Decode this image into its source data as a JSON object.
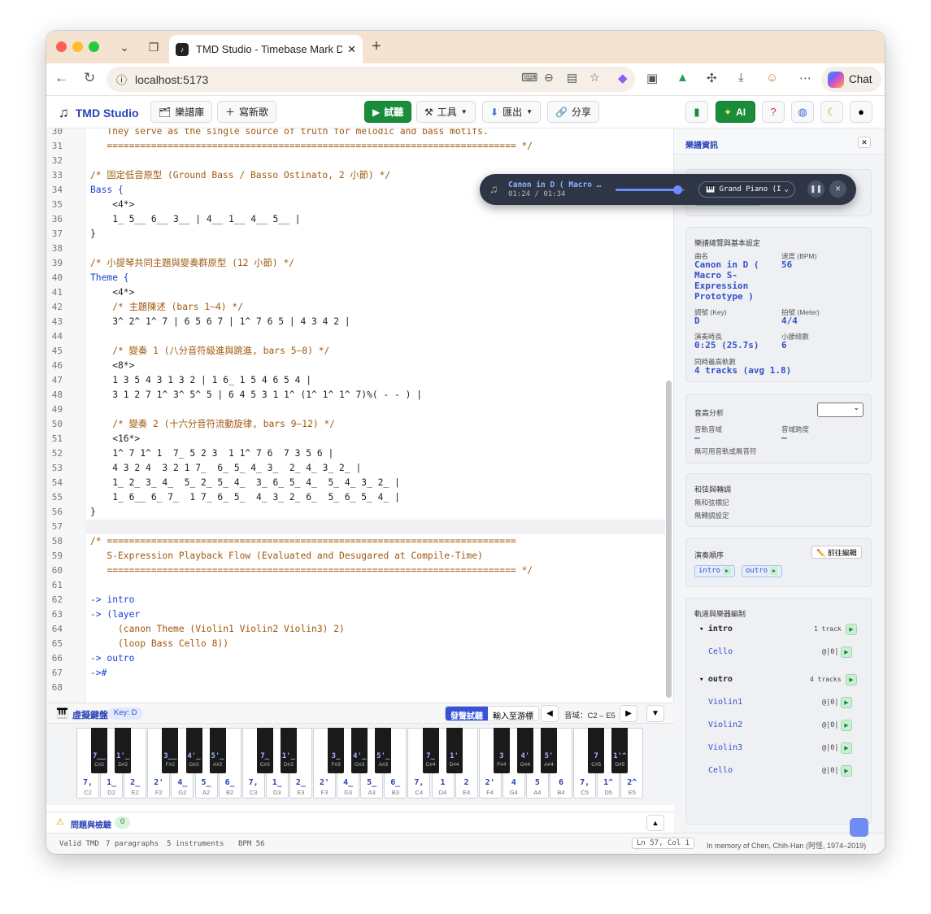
{
  "browser": {
    "tab_title": "TMD Studio - Timebase Mark Do",
    "url": "localhost:5173",
    "chat_label": "Chat"
  },
  "header": {
    "app_name": "TMD Studio",
    "library": "樂譜庫",
    "new_song": "寫新歌",
    "play": "試聽",
    "tools": "工具",
    "export": "匯出",
    "share": "分享",
    "ai": "AI"
  },
  "editor": {
    "lines": [
      {
        "n": "30",
        "t": "   They serve as the single source of truth for melodic and bass motifs.",
        "c": "cm"
      },
      {
        "n": "31",
        "t": "   ========================================================================== */",
        "c": "cm"
      },
      {
        "n": "32",
        "t": "",
        "c": ""
      },
      {
        "n": "33",
        "t": "/* 固定低音原型 (Ground Bass / Basso Ostinato, 2 小節) */",
        "c": "cm"
      },
      {
        "n": "34",
        "t": "Bass {",
        "c": "kw"
      },
      {
        "n": "35",
        "t": "    <4*>",
        "c": ""
      },
      {
        "n": "36",
        "t": "    1_ 5__ 6__ 3__ | 4__ 1__ 4__ 5__ |",
        "c": ""
      },
      {
        "n": "37",
        "t": "}",
        "c": ""
      },
      {
        "n": "38",
        "t": "",
        "c": ""
      },
      {
        "n": "39",
        "t": "/* 小提琴共同主題與變奏群原型 (12 小節) */",
        "c": "cm"
      },
      {
        "n": "40",
        "t": "Theme {",
        "c": "kw"
      },
      {
        "n": "41",
        "t": "    <4*>",
        "c": ""
      },
      {
        "n": "42",
        "t": "    /* 主題陳述 (bars 1–4) */",
        "c": "cm"
      },
      {
        "n": "43",
        "t": "    3^ 2^ 1^ 7 | 6 5 6 7 | 1^ 7 6 5 | 4 3 4 2 |",
        "c": ""
      },
      {
        "n": "44",
        "t": "",
        "c": ""
      },
      {
        "n": "45",
        "t": "    /* 變奏 1 (八分音符級進與跳進, bars 5–8) */",
        "c": "cm"
      },
      {
        "n": "46",
        "t": "    <8*>",
        "c": ""
      },
      {
        "n": "47",
        "t": "    1 3 5 4 3 1 3 2 | 1 6_ 1 5 4 6 5 4 |",
        "c": ""
      },
      {
        "n": "48",
        "t": "    3 1 2 7 1^ 3^ 5^ 5 | 6 4 5 3 1 1^ (1^ 1^ 1^ 7)%( - - ) |",
        "c": ""
      },
      {
        "n": "49",
        "t": "",
        "c": ""
      },
      {
        "n": "50",
        "t": "    /* 變奏 2 (十六分音符流動旋律, bars 9–12) */",
        "c": "cm"
      },
      {
        "n": "51",
        "t": "    <16*>",
        "c": ""
      },
      {
        "n": "52",
        "t": "    1^ 7 1^ 1  7_ 5 2 3  1 1^ 7 6  7 3 5 6 |",
        "c": ""
      },
      {
        "n": "53",
        "t": "    4 3 2 4  3 2 1 7_  6_ 5_ 4_ 3_  2_ 4_ 3_ 2_ |",
        "c": ""
      },
      {
        "n": "54",
        "t": "    1_ 2_ 3_ 4_  5_ 2_ 5_ 4_  3_ 6_ 5_ 4_  5_ 4_ 3_ 2_ |",
        "c": ""
      },
      {
        "n": "55",
        "t": "    1_ 6__ 6_ 7_  1 7_ 6_ 5_  4_ 3_ 2_ 6_  5_ 6_ 5_ 4_ |",
        "c": ""
      },
      {
        "n": "56",
        "t": "}",
        "c": ""
      },
      {
        "n": "57",
        "t": "",
        "c": ""
      },
      {
        "n": "58",
        "t": "/* ==========================================================================",
        "c": "cm"
      },
      {
        "n": "59",
        "t": "   S-Expression Playback Flow (Evaluated and Desugared at Compile-Time)",
        "c": "cm"
      },
      {
        "n": "60",
        "t": "   ========================================================================== */",
        "c": "cm"
      },
      {
        "n": "61",
        "t": "",
        "c": ""
      },
      {
        "n": "62",
        "t": "-> intro",
        "c": "ar"
      },
      {
        "n": "63",
        "t": "-> (layer",
        "c": "ar"
      },
      {
        "n": "64",
        "t": "     (canon Theme (Violin1 Violin2 Violin3) 2)",
        "c": "fn"
      },
      {
        "n": "65",
        "t": "     (loop Bass Cello 8))",
        "c": "fn"
      },
      {
        "n": "66",
        "t": "-> outro",
        "c": "ar"
      },
      {
        "n": "67",
        "t": "->#",
        "c": "ar"
      },
      {
        "n": "68",
        "t": "",
        "c": ""
      }
    ]
  },
  "keyboard": {
    "title": "虛擬鍵盤",
    "key_badge": "Key: D",
    "mode_on": "發聲試聽",
    "mode_off": "輸入至游標",
    "range": "音域：C2 – E5",
    "white": [
      {
        "l": "7,",
        "n": "C2"
      },
      {
        "l": "1_",
        "n": "D2"
      },
      {
        "l": "2_",
        "n": "E2"
      },
      {
        "l": "2'",
        "n": "F2"
      },
      {
        "l": "4_",
        "n": "G2"
      },
      {
        "l": "5_",
        "n": "A2"
      },
      {
        "l": "6_",
        "n": "B2"
      },
      {
        "l": "7,",
        "n": "C3"
      },
      {
        "l": "1_",
        "n": "D3"
      },
      {
        "l": "2_",
        "n": "E3"
      },
      {
        "l": "2'",
        "n": "F3"
      },
      {
        "l": "4_",
        "n": "G3"
      },
      {
        "l": "5_",
        "n": "A3"
      },
      {
        "l": "6_",
        "n": "B3"
      },
      {
        "l": "7,",
        "n": "C4"
      },
      {
        "l": "1",
        "n": "D4"
      },
      {
        "l": "2",
        "n": "E4"
      },
      {
        "l": "2'",
        "n": "F4"
      },
      {
        "l": "4",
        "n": "G4"
      },
      {
        "l": "5",
        "n": "A4"
      },
      {
        "l": "6",
        "n": "B4"
      },
      {
        "l": "7,",
        "n": "C5"
      },
      {
        "l": "1^",
        "n": "D5"
      },
      {
        "l": "2^",
        "n": "E5"
      }
    ],
    "black": [
      {
        "l": "7__",
        "n": "C#2"
      },
      {
        "l": "1'_",
        "n": "D#2"
      },
      {
        "l": "3__",
        "n": "F#2"
      },
      {
        "l": "4'_",
        "n": "G#2"
      },
      {
        "l": "5'_",
        "n": "A#2"
      },
      {
        "l": "7_",
        "n": "C#3"
      },
      {
        "l": "1'_",
        "n": "D#3"
      },
      {
        "l": "3_",
        "n": "F#3"
      },
      {
        "l": "4'_",
        "n": "G#3"
      },
      {
        "l": "5'_",
        "n": "A#3"
      },
      {
        "l": "7_",
        "n": "C#4"
      },
      {
        "l": "1'",
        "n": "D#4"
      },
      {
        "l": "3",
        "n": "F#4"
      },
      {
        "l": "4'",
        "n": "G#4"
      },
      {
        "l": "5'",
        "n": "A#4"
      },
      {
        "l": "7",
        "n": "C#5"
      },
      {
        "l": "1'^",
        "n": "D#5"
      }
    ]
  },
  "problems": {
    "title": "問題與檢驗",
    "count": "0"
  },
  "status": {
    "valid": "Valid TMD",
    "paragraphs": "7 paragraphs",
    "instruments": "5 instruments",
    "bpm": "BPM 56",
    "cursor": "Ln 57, Col 1",
    "memorial": "In memory of Chen, Chih-Han (阿怪, 1974–2019)"
  },
  "player": {
    "title": "Canon in D ( Macro …",
    "time": "01:24 / 01:34",
    "progress": 0.89,
    "instrument": "🎹 Grand Piano (I"
  },
  "panel": {
    "title": "樂譜資訊",
    "overview_title": "樂譜總覽與基本設定",
    "song_lbl": "曲名",
    "song": "Canon in D ( Macro S-Expression Prototype )",
    "tempo_lbl": "速度 (BPM)",
    "tempo": "56",
    "key_lbl": "調號 (Key)",
    "key": "D",
    "meter_lbl": "拍號 (Meter)",
    "meter": "4/4",
    "dur_lbl": "演奏時長",
    "dur": "0:25 (25.7s)",
    "bars_lbl": "小節總數",
    "bars": "6",
    "tracks_lbl": "同時最高軌數",
    "tracks": "4 tracks (avg 1.8)",
    "range_title": "音高分析",
    "range_a_lbl": "音軌音域",
    "range_a": "–",
    "range_b_lbl": "音域跨度",
    "range_b": "–",
    "range_note": "無可用音軌或無音符",
    "chord_title": "和弦與轉調",
    "chord_1": "無和弦標記",
    "chord_2": "無轉調設定",
    "order_title": "演奏順序",
    "order_edit": "前往編輯",
    "order": [
      "intro",
      "outro"
    ],
    "inst_title": "軌道與樂器編制",
    "groups": [
      {
        "name": "intro",
        "count": "1 track",
        "tracks": [
          {
            "name": "Cello",
            "meta": "@|0|"
          }
        ]
      },
      {
        "name": "outro",
        "count": "4 tracks",
        "tracks": [
          {
            "name": "Violin1",
            "meta": "@|0|"
          },
          {
            "name": "Violin2",
            "meta": "@|0|"
          },
          {
            "name": "Violin3",
            "meta": "@|0|"
          },
          {
            "name": "Cello",
            "meta": "@|0|"
          }
        ]
      }
    ]
  }
}
